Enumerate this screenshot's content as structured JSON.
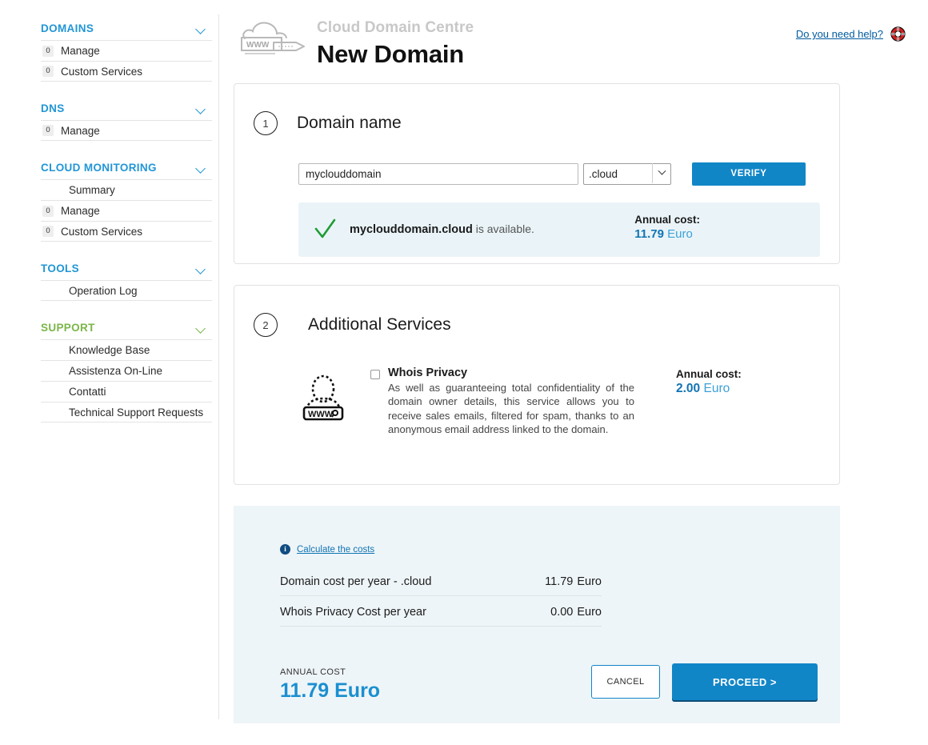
{
  "sidebar": {
    "groups": [
      {
        "title": "DOMAINS",
        "color": "#2196d6",
        "items": [
          {
            "badge": "0",
            "label": "Manage"
          },
          {
            "badge": "0",
            "label": "Custom Services"
          }
        ]
      },
      {
        "title": "DNS",
        "color": "#2196d6",
        "items": [
          {
            "badge": "0",
            "label": "Manage"
          }
        ]
      },
      {
        "title": "CLOUD MONITORING",
        "color": "#2196d6",
        "items": [
          {
            "badge": "",
            "label": "Summary"
          },
          {
            "badge": "0",
            "label": "Manage"
          },
          {
            "badge": "0",
            "label": "Custom Services"
          }
        ]
      },
      {
        "title": "TOOLS",
        "color": "#2196d6",
        "items": [
          {
            "badge": "",
            "label": "Operation Log"
          }
        ]
      },
      {
        "title": "SUPPORT",
        "color": "#7ab648",
        "items": [
          {
            "badge": "",
            "label": "Knowledge Base"
          },
          {
            "badge": "",
            "label": "Assistenza On-Line"
          },
          {
            "badge": "",
            "label": "Contatti"
          },
          {
            "badge": "",
            "label": "Technical Support Requests"
          }
        ]
      }
    ]
  },
  "header": {
    "brand": "Cloud Domain Centre",
    "title": "New Domain",
    "help_label": "Do you need help?",
    "help_icon": "lifering-icon",
    "logo_icon": "cloud-www-logo-icon"
  },
  "step1": {
    "number": "1",
    "title": "Domain name",
    "input_value": "myclouddomain",
    "input_placeholder": "",
    "tld_selected": ".cloud",
    "tld_options": [
      ".cloud"
    ],
    "verify_label": "VERIFY",
    "availability": {
      "icon": "check-icon",
      "domain": "myclouddomain.cloud",
      "message": " is available.",
      "cost_label": "Annual cost:",
      "cost_value": "11.79",
      "cost_currency": "Euro"
    }
  },
  "step2": {
    "number": "2",
    "title": "Additional Services",
    "service": {
      "icon": "whois-privacy-icon",
      "checked": false,
      "name": "Whois Privacy",
      "description": "As well as guaranteeing total confidentiality of the domain owner details, this service allows you to receive sales emails, filtered for spam, thanks to an anonymous email address linked to the domain.",
      "cost_label": "Annual cost:",
      "cost_value": "2.00",
      "cost_currency": "Euro"
    }
  },
  "summary": {
    "calc_icon": "info-icon",
    "calc_link": "Calculate the costs",
    "lines": [
      {
        "label": "Domain cost per year - .cloud",
        "amount": "11.79",
        "currency": "Euro"
      },
      {
        "label": "Whois Privacy Cost per year",
        "amount": "0.00",
        "currency": "Euro"
      }
    ],
    "total_label": "ANNUAL COST",
    "total_value": "11.79 Euro",
    "cancel_label": "CANCEL",
    "proceed_label": "PROCEED >"
  },
  "colors": {
    "accent_blue": "#1186c7",
    "link_blue": "#1174b5",
    "nav_blue": "#2196d6",
    "support_green": "#7ab648",
    "panel_bg": "#eef5f8",
    "avail_bg": "#eaf4f8",
    "check_green": "#1f9b34"
  }
}
